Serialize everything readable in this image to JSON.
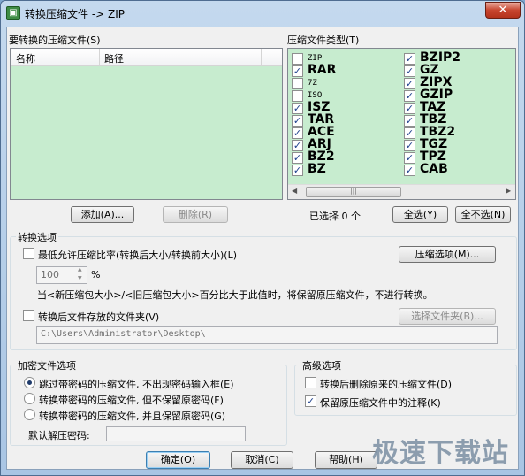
{
  "window": {
    "title": "转换压缩文件 -> ZIP",
    "app_icon_glyph": "▣",
    "close_glyph": "✕"
  },
  "source_files": {
    "label": "要转换的压缩文件(S)",
    "columns": [
      "名称",
      "路径"
    ],
    "add_label": "添加(A)...",
    "remove_label": "删除(R)"
  },
  "archive_types": {
    "label": "压缩文件类型(T)",
    "left": [
      {
        "name": "ZIP",
        "checked": false,
        "size": "small"
      },
      {
        "name": "RAR",
        "checked": true,
        "size": "big"
      },
      {
        "name": "7Z",
        "checked": false,
        "size": "small"
      },
      {
        "name": "ISO",
        "checked": false,
        "size": "small"
      },
      {
        "name": "ISZ",
        "checked": true,
        "size": "big"
      },
      {
        "name": "TAR",
        "checked": true,
        "size": "big"
      },
      {
        "name": "ACE",
        "checked": true,
        "size": "big"
      },
      {
        "name": "ARJ",
        "checked": true,
        "size": "big"
      },
      {
        "name": "BZ2",
        "checked": true,
        "size": "big"
      },
      {
        "name": "BZ",
        "checked": true,
        "size": "big"
      }
    ],
    "right": [
      {
        "name": "BZIP2",
        "checked": true,
        "size": "big"
      },
      {
        "name": "GZ",
        "checked": true,
        "size": "big"
      },
      {
        "name": "ZIPX",
        "checked": true,
        "size": "big"
      },
      {
        "name": "GZIP",
        "checked": true,
        "size": "big"
      },
      {
        "name": "TAZ",
        "checked": true,
        "size": "big"
      },
      {
        "name": "TBZ",
        "checked": true,
        "size": "big"
      },
      {
        "name": "TBZ2",
        "checked": true,
        "size": "big"
      },
      {
        "name": "TGZ",
        "checked": true,
        "size": "big"
      },
      {
        "name": "TPZ",
        "checked": true,
        "size": "big"
      },
      {
        "name": "CAB",
        "checked": true,
        "size": "big"
      }
    ],
    "selected_count_text": "已选择 0 个",
    "select_all_label": "全选(Y)",
    "select_none_label": "全不选(N)"
  },
  "convert_options": {
    "label": "转换选项",
    "min_ratio_label": "最低允许压缩比率(转换后大小/转换前大小)(L)",
    "min_ratio_checked": false,
    "ratio_value": "100",
    "ratio_unit": "%",
    "compress_options_label": "压缩选项(M)...",
    "ratio_hint": "当<新压缩包大小>/<旧压缩包大小>百分比大于此值时，将保留原压缩文件，不进行转换。",
    "dest_folder_label": "转换后文件存放的文件夹(V)",
    "dest_folder_checked": false,
    "choose_folder_label": "选择文件夹(B)...",
    "dest_path": "C:\\Users\\Administrator\\Desktop\\"
  },
  "encryption": {
    "label": "加密文件选项",
    "options": [
      {
        "label": "跳过带密码的压缩文件, 不出现密码输入框(E)",
        "selected": true
      },
      {
        "label": "转换带密码的压缩文件, 但不保留原密码(F)",
        "selected": false
      },
      {
        "label": "转换带密码的压缩文件, 并且保留原密码(G)",
        "selected": false
      }
    ],
    "default_password_label": "默认解压密码:"
  },
  "advanced": {
    "label": "高级选项",
    "delete_original_label": "转换后删除原来的压缩文件(D)",
    "delete_original_checked": false,
    "keep_comment_label": "保留原压缩文件中的注释(K)",
    "keep_comment_checked": true
  },
  "footer": {
    "ok_label": "确定(O)",
    "cancel_label": "取消(C)",
    "help_label": "帮助(H)"
  },
  "watermark": "极速下载站",
  "icons": {
    "check": "✓",
    "scroll_left": "◀",
    "scroll_right": "▶",
    "spin_up": "▲",
    "spin_down": "▼",
    "thumb_grip": "|||"
  }
}
